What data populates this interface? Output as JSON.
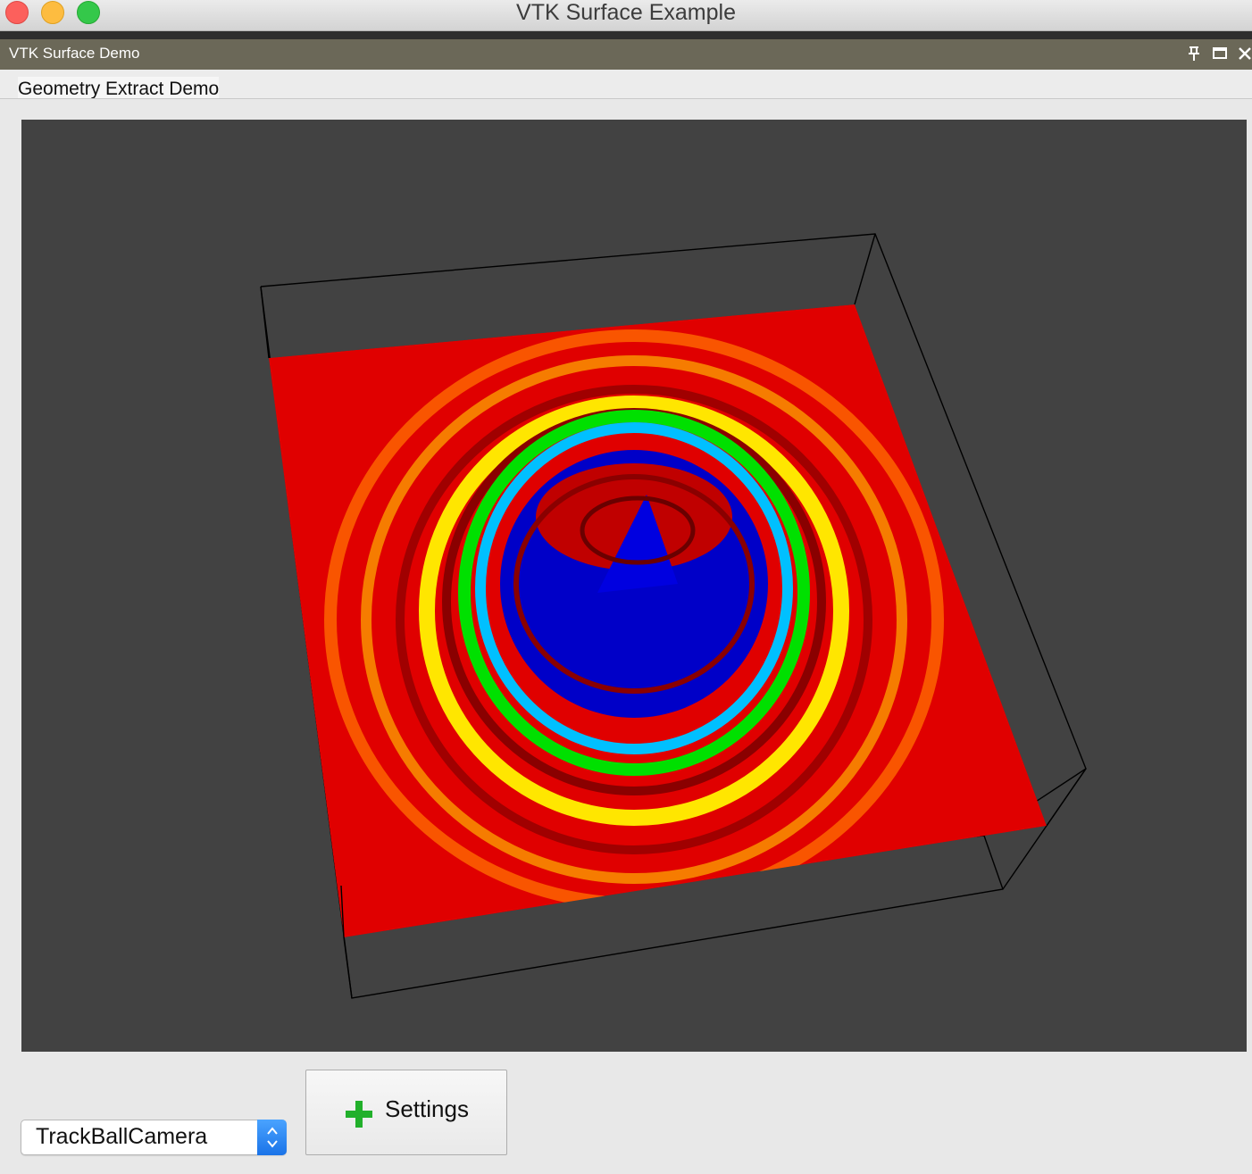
{
  "window": {
    "title": "VTK Surface Example"
  },
  "dock": {
    "title": "VTK Surface Demo",
    "buttons": [
      "pin-icon",
      "float-icon",
      "close-icon"
    ]
  },
  "tabs": [
    {
      "label": "Geometry Extract Demo",
      "active": true
    }
  ],
  "viewport": {
    "background": "#424242",
    "surface_colors": [
      "#e00000",
      "#ffff00",
      "#00e000",
      "#00c0ff",
      "#0000c8"
    ]
  },
  "controls": {
    "interactor_style": {
      "selected": "TrackBallCamera"
    },
    "settings_button": {
      "label": "Settings",
      "icon": "plus-icon"
    }
  }
}
